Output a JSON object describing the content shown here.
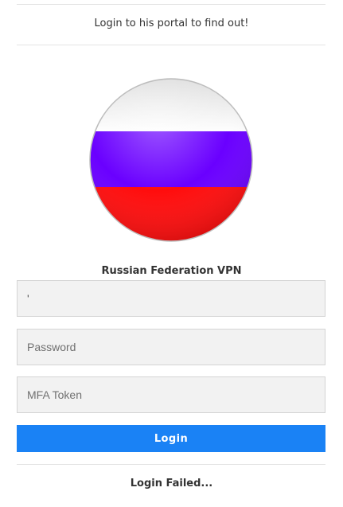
{
  "intro": {
    "text": "Login to his portal to find out!"
  },
  "vpn": {
    "heading": "Russian Federation VPN",
    "flag_icon": "russia-flag-sphere-icon",
    "flag_colors": [
      "#ffffff",
      "#6a00ff",
      "#ff0d0d"
    ]
  },
  "form": {
    "username": {
      "value": "'",
      "placeholder": ""
    },
    "password": {
      "value": "",
      "placeholder": "Password"
    },
    "mfa": {
      "value": "",
      "placeholder": "MFA Token"
    },
    "login_label": "Login"
  },
  "status": {
    "text": "Login Failed..."
  },
  "colors": {
    "accent": "#1a82f5",
    "divider": "#e3e3e3",
    "field_bg": "#f2f2f2"
  }
}
